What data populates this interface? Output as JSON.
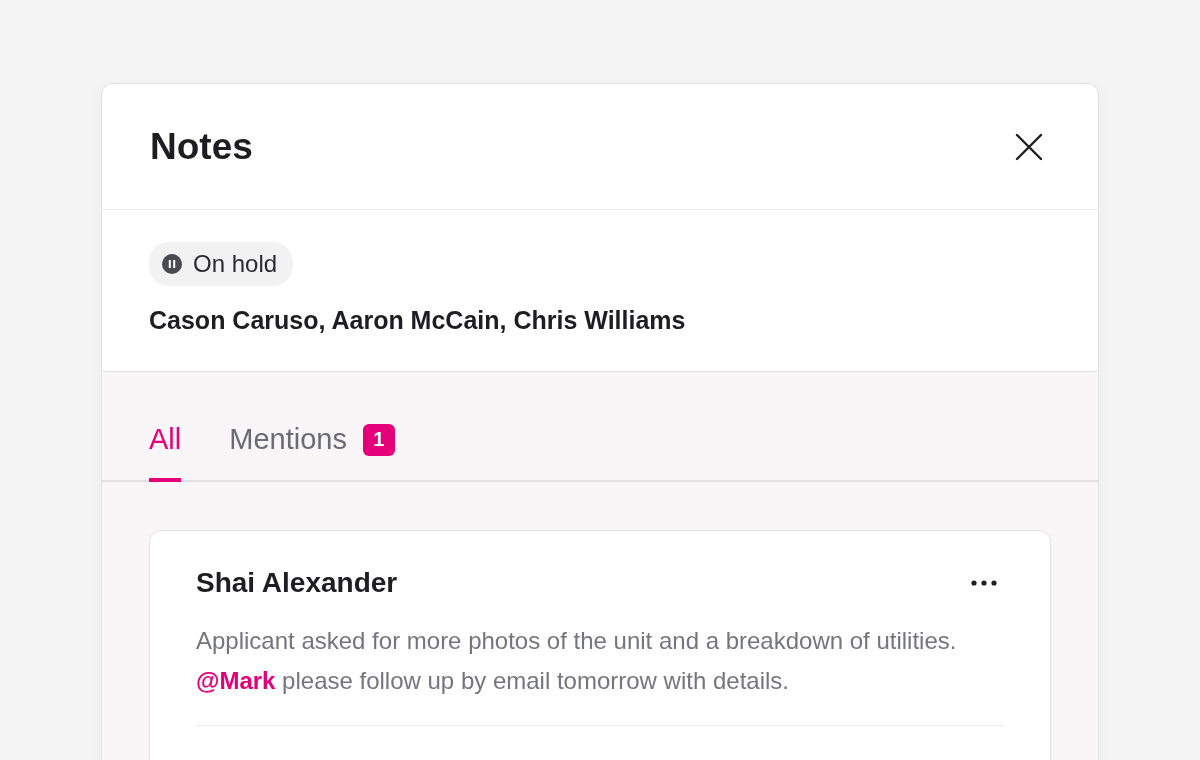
{
  "panel": {
    "title": "Notes"
  },
  "status": {
    "label": "On hold"
  },
  "participants": "Cason Caruso, Aaron McCain, Chris Williams",
  "tabs": [
    {
      "label": "All",
      "selected": true
    },
    {
      "label": "Mentions",
      "selected": false,
      "badge": "1"
    }
  ],
  "notes": [
    {
      "author": "Shai Alexander",
      "text": "Applicant asked for more photos of the unit and a breakdown of utilities. **@Mark** please follow up by email tomorrow with details."
    }
  ]
}
